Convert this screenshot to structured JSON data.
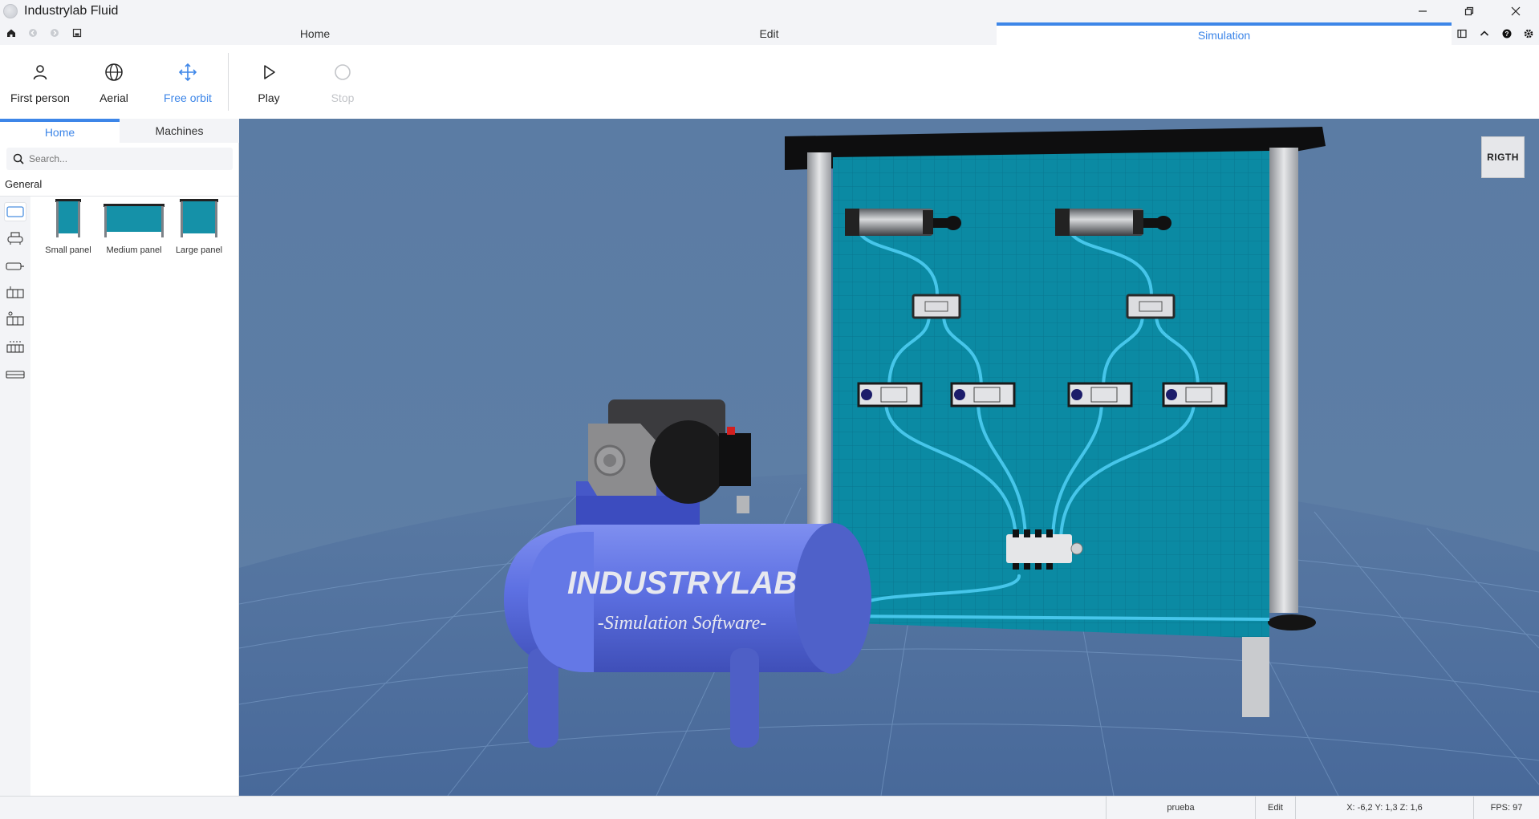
{
  "titlebar": {
    "title": "Industrylab Fluid",
    "controls": [
      "minimize-icon",
      "restore-icon",
      "close-icon"
    ]
  },
  "quick_access": [
    "home-icon",
    "back-icon",
    "forward-icon",
    "save-icon"
  ],
  "main_tabs": [
    {
      "label": "Home",
      "active": false
    },
    {
      "label": "Edit",
      "active": false
    },
    {
      "label": "Simulation",
      "active": true
    }
  ],
  "right_tools": [
    "panel-toggle-icon",
    "collapse-ribbon-icon",
    "help-icon",
    "settings-icon"
  ],
  "ribbon": {
    "camera": [
      {
        "label": "First person",
        "icon": "person-icon",
        "active": false
      },
      {
        "label": "Aerial",
        "icon": "globe-icon",
        "active": false
      },
      {
        "label": "Free orbit",
        "icon": "move-arrows-icon",
        "active": true
      }
    ],
    "play_label": "Play",
    "stop_label": "Stop",
    "stop_enabled": false
  },
  "left_panel": {
    "tabs": [
      {
        "label": "Home",
        "active": true
      },
      {
        "label": "Machines",
        "active": false
      }
    ],
    "search_placeholder": "Search...",
    "category_title": "General",
    "category_icons": [
      "panel-category-icon",
      "compressor-category-icon",
      "cylinder-category-icon",
      "valve-category-icon",
      "valve-set-category-icon",
      "manifold-category-icon",
      "profile-category-icon"
    ],
    "items": [
      {
        "label": "Small panel"
      },
      {
        "label": "Medium panel"
      },
      {
        "label": "Large panel"
      }
    ]
  },
  "viewport": {
    "view_cube_label": "RIGTH",
    "compressor_brand": "INDUSTRYLAB",
    "compressor_tagline": "-Simulation Software-",
    "colors": {
      "sky": "#5879a1",
      "floor": "#4f73a0",
      "panel": "#0a8aa3",
      "tube": "#46c6ea",
      "tank": "#5b6fe0",
      "accent": "#3d86e8"
    }
  },
  "status_bar": {
    "project_name": "prueba",
    "mode": "Edit",
    "coords": "X: -6,2  Y: 1,3  Z: 1,6",
    "fps": "FPS: 97"
  }
}
